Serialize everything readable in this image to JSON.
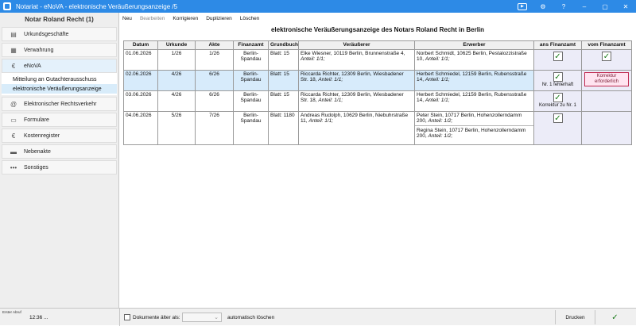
{
  "window": {
    "title": "Notariat - eNoVA - elektronische Veräußerungsanzeige /5",
    "controls": {
      "youtube": "▶",
      "settings": "⚙",
      "help": "?",
      "minimize": "–",
      "maximize": "▢",
      "close": "✕"
    }
  },
  "sidebar": {
    "title": "Notar Roland Recht (1)",
    "items": [
      {
        "label": "Urkundsgeschäfte",
        "icon": "certificate-icon"
      },
      {
        "label": "Verwahrung",
        "icon": "safe-icon"
      },
      {
        "label": "eNoVA",
        "icon": "enova-icon"
      },
      {
        "label": "Elektronischer Rechtsverkehr",
        "icon": "at-icon"
      },
      {
        "label": "Formulare",
        "icon": "form-icon"
      },
      {
        "label": "Kostenregister",
        "icon": "euro-icon"
      },
      {
        "label": "Nebenakte",
        "icon": "folder-icon"
      },
      {
        "label": "Sonstiges",
        "icon": "more-icon"
      }
    ],
    "subitems": [
      {
        "label": "Mitteilung an Gutachterausschuss"
      },
      {
        "label": "elektronische Veräußerungsanzeige"
      }
    ]
  },
  "toolbar": {
    "new": "Neu",
    "edit": "Bearbeiten",
    "correct": "Korrigieren",
    "duplicate": "Duplizieren",
    "delete": "Löschen"
  },
  "main": {
    "title": "elektronische Veräußerungsanzeige des Notars Roland Recht in Berlin",
    "columns": [
      "Datum",
      "Urkunde",
      "Akte",
      "Finanzamt",
      "Grundbuch",
      "Veräußerer",
      "Erwerber",
      "ans Finanzamt",
      "vom Finanzamt"
    ],
    "rows": [
      {
        "date": "01.06.2026",
        "urkunde": "1/26",
        "akte": "1/26",
        "finanzamt": "Berlin-Spandau",
        "grundbuch": "Blatt: 15",
        "veraeusserer": "Elke Wiesner, 10119 Berlin, Brunnenstraße 4,",
        "veraeusserer_share": "Anteil: 1/1;",
        "erwerber": "Norbert Schmidt, 10625 Berlin, Pestalozzistraße 10,",
        "erwerber_share": "Anteil: 1/1;",
        "ans_note": "",
        "vom_note": ""
      },
      {
        "date": "02.06.2026",
        "urkunde": "4/26",
        "akte": "6/26",
        "finanzamt": "Berlin-Spandau",
        "grundbuch": "Blatt: 15",
        "veraeusserer": "Riccarda Richter, 12309 Berlin, Wiesbadener Str. 18,",
        "veraeusserer_share": "Anteil: 1/1;",
        "erwerber": "Herbert Schmiedel, 12159 Berlin, Rubensstraße 14,",
        "erwerber_share": "Anteil: 1/1;",
        "ans_note": "Nr. 1 fehlerhaft",
        "vom_note": "Korrektur erforderlich"
      },
      {
        "date": "03.06.2026",
        "urkunde": "4/26",
        "akte": "6/26",
        "finanzamt": "Berlin-Spandau",
        "grundbuch": "Blatt: 15",
        "veraeusserer": "Riccarda Richter, 12309 Berlin, Wiesbadener Str. 18,",
        "veraeusserer_share": "Anteil: 1/1;",
        "erwerber": "Herbert Schmiedel, 12159 Berlin, Rubensstraße 14,",
        "erwerber_share": "Anteil: 1/1;",
        "ans_note": "Korrektur zu Nr. 1",
        "vom_note": ""
      },
      {
        "date": "04.06.2026",
        "urkunde": "5/26",
        "akte": "7/26",
        "finanzamt": "Berlin-Spandau",
        "grundbuch": "Blatt: 1180",
        "veraeusserer": "Andreas Rudolph, 10629 Berlin, Niebuhrstraße 11,",
        "veraeusserer_share": "Anteil: 1/1;",
        "erwerber": "Peter Stein, 10717 Berlin, Hohenzollerndamm 200,",
        "erwerber_share": "Anteil: 1/2;",
        "erwerber2": "Regina Stein, 10717 Berlin, Hohenzollerndamm 200,",
        "erwerber2_share": "Anteil: 1/2;",
        "ans_note": "",
        "vom_note": ""
      }
    ]
  },
  "statusbar": {
    "label": "Erster Abruf",
    "time": "12:36 ...",
    "checkbox_label": "Dokumente älter als:",
    "select_value": "",
    "auto_delete": "automatisch löschen",
    "print": "Drucken",
    "ok": "✓"
  }
}
